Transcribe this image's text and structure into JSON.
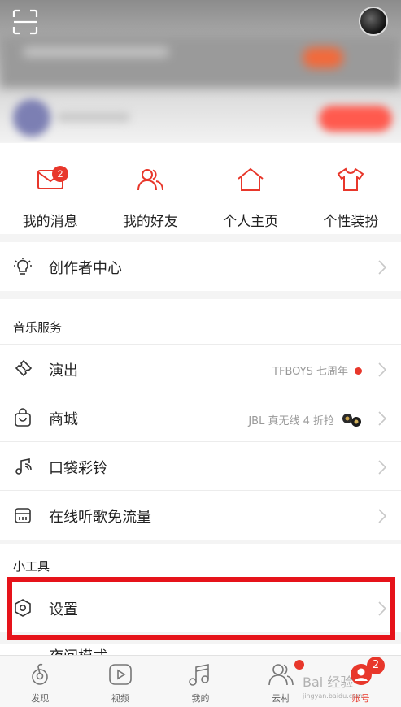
{
  "colors": {
    "accent": "#e8372b",
    "highlight_box": "#e6131a"
  },
  "header": {
    "scan_icon": "scan-icon",
    "avatar": "avatar"
  },
  "quick": [
    {
      "label": "我的消息",
      "icon": "mail-icon",
      "badge": "2"
    },
    {
      "label": "我的好友",
      "icon": "friends-icon"
    },
    {
      "label": "个人主页",
      "icon": "home-icon"
    },
    {
      "label": "个性装扮",
      "icon": "tshirt-icon"
    }
  ],
  "creator": {
    "label": "创作者中心",
    "icon": "lightbulb-icon"
  },
  "music_services": {
    "title": "音乐服务",
    "items": [
      {
        "label": "演出",
        "hint": "TFBOYS 七周年",
        "icon": "ticket-icon"
      },
      {
        "label": "商城",
        "hint": "JBL 真无线 4 折抢",
        "icon": "bag-icon"
      },
      {
        "label": "口袋彩铃",
        "icon": "ringtone-icon"
      },
      {
        "label": "在线听歌免流量",
        "icon": "sim-icon"
      }
    ]
  },
  "tools": {
    "title": "小工具",
    "items": [
      {
        "label": "设置",
        "icon": "settings-icon"
      },
      {
        "label": "夜间模式",
        "icon": "moon-icon"
      }
    ]
  },
  "tabbar": {
    "tabs": [
      {
        "label": "发现",
        "icon": "discover-icon"
      },
      {
        "label": "视频",
        "icon": "video-icon"
      },
      {
        "label": "我的",
        "icon": "music-note-icon"
      },
      {
        "label": "云村",
        "icon": "cloud-village-icon"
      },
      {
        "label": "账号",
        "icon": "account-icon",
        "badge": "2"
      }
    ],
    "active_index": 4
  },
  "watermark": {
    "text": "Bai 经验",
    "sub": "jingyan.baidu.com"
  }
}
